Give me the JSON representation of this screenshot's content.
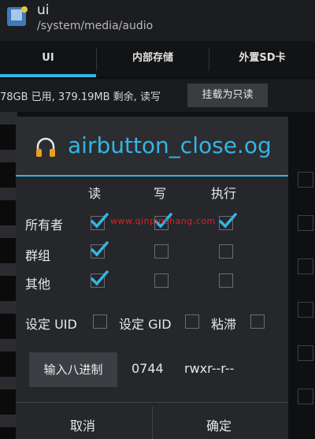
{
  "app": {
    "title": "ui",
    "path": "/system/media/audio"
  },
  "tabs": [
    {
      "label": "UI"
    },
    {
      "label": "内部存储"
    },
    {
      "label": "外置SD卡"
    }
  ],
  "info": {
    "text": "78GB 已用, 379.19MB 剩余, 读写",
    "readonly_button": "挂载为只读"
  },
  "dialog": {
    "title": "airbutton_close.og",
    "columns": {
      "read": "读",
      "write": "写",
      "execute": "执行"
    },
    "rows": [
      {
        "label": "所有者",
        "read": true,
        "write": true,
        "execute": true
      },
      {
        "label": "群组",
        "read": true,
        "write": false,
        "execute": false
      },
      {
        "label": "其他",
        "read": true,
        "write": false,
        "execute": false
      }
    ],
    "options": {
      "set_uid": "设定 UID",
      "set_gid": "设定 GID",
      "sticky": "粘滞"
    },
    "octal_button": "输入八进制",
    "octal_value": "0744",
    "symbolic_value": "rwxr--r--",
    "cancel": "取消",
    "confirm": "确定"
  },
  "watermark": "www.qinpinchang.com",
  "colors": {
    "accent": "#33b5e5",
    "dialog_bg": "#25272b",
    "watermark": "#e02020"
  }
}
